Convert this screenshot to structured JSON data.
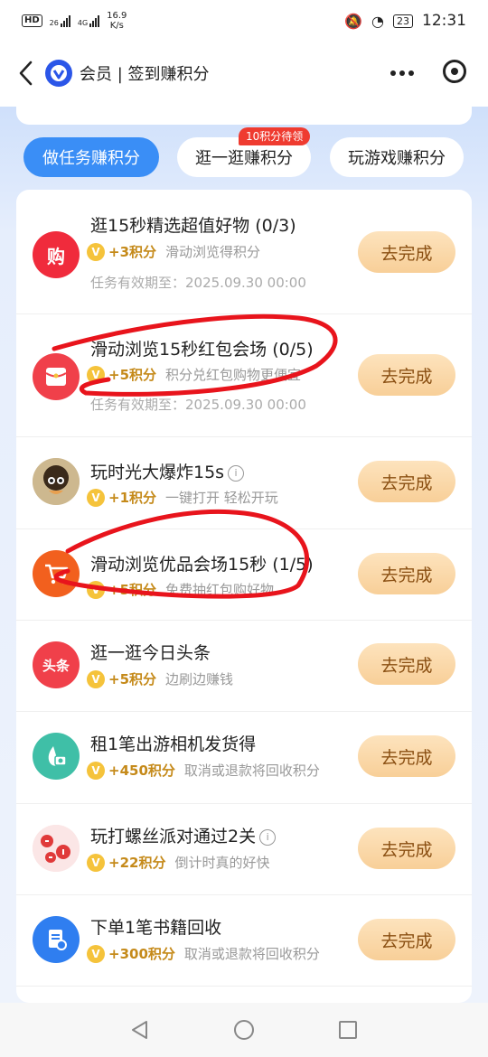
{
  "status": {
    "hd": "HD",
    "net1": "26",
    "net2": "4G",
    "speed_value": "16.9",
    "speed_unit": "K/s",
    "battery": "23",
    "time": "12:31"
  },
  "nav": {
    "back_icon": "chevron-left-icon",
    "title": "会员 | 签到赚积分",
    "more_icon": "more-icon",
    "target_icon": "target-icon"
  },
  "tabs": [
    {
      "label": "做任务赚积分",
      "active": true
    },
    {
      "label": "逛一逛赚积分",
      "active": false,
      "badge": "10积分待领"
    },
    {
      "label": "玩游戏赚积分",
      "active": false
    }
  ],
  "tasks": [
    {
      "title": "逛15秒精选超值好物 (0/3)",
      "points": "+3积分",
      "desc": "滑动浏览得积分",
      "expire": "任务有效期至：2025.09.30 00:00",
      "button": "去完成",
      "icon_text": "购",
      "icon_color": "#f02b3c"
    },
    {
      "title": "滑动浏览15秒红包会场 (0/5)",
      "points": "+5积分",
      "desc": "积分兑红包购物更便宜",
      "expire": "任务有效期至：2025.09.30 00:00",
      "button": "去完成",
      "icon_text": "",
      "icon_color": "#f0404a"
    },
    {
      "title": "玩时光大爆炸15s",
      "info": "i",
      "points": "+1积分",
      "desc": "一键打开 轻松开玩",
      "button": "去完成",
      "icon_text": "",
      "icon_color": "#6b5a3a"
    },
    {
      "title": "滑动浏览优品会场15秒 (1/5)",
      "points": "+5积分",
      "desc": "免费抽红包购好物",
      "button": "去完成",
      "icon_text": "",
      "icon_color": "#f2601e"
    },
    {
      "title": "逛一逛今日头条",
      "points": "+5积分",
      "desc": "边刷边赚钱",
      "button": "去完成",
      "icon_text": "头条",
      "icon_color": "#f0404a"
    },
    {
      "title": "租1笔出游相机发货得",
      "points": "+450积分",
      "desc": "取消或退款将回收积分",
      "button": "去完成",
      "icon_text": "",
      "icon_color": "#3fbfa7"
    },
    {
      "title": "玩打螺丝派对通过2关",
      "info": "i",
      "points": "+22积分",
      "desc": "倒计时真的好快",
      "button": "去完成",
      "icon_text": "",
      "icon_color": "#e84a4a"
    },
    {
      "title": "下单1笔书籍回收",
      "points": "+300积分",
      "desc": "取消或退款将回收积分",
      "button": "去完成",
      "icon_text": "",
      "icon_color": "#2f7ef0"
    }
  ],
  "coin_label": "V",
  "bottom_nav": [
    "back-triangle-icon",
    "home-circle-icon",
    "recents-square-icon"
  ],
  "colors": {
    "accent": "#3a8ef6",
    "badge": "#ef3b30",
    "button_text": "#8a4f12",
    "annotation": "#e8141c"
  }
}
